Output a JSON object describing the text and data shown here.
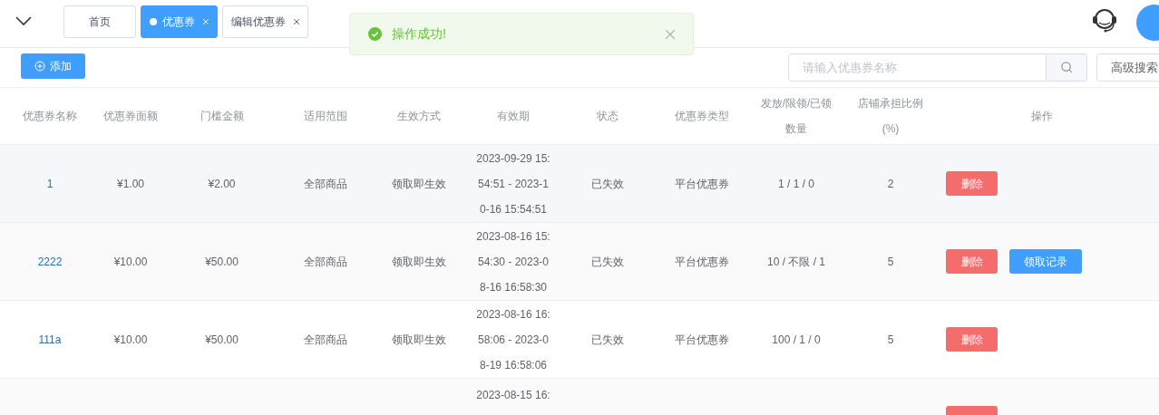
{
  "tabs": [
    {
      "label": "首页",
      "selected": false,
      "closable": false
    },
    {
      "label": "优惠券",
      "selected": true,
      "closable": true
    },
    {
      "label": "编辑优惠券",
      "selected": false,
      "closable": true
    }
  ],
  "toast": {
    "message": "操作成功!"
  },
  "toolbar": {
    "add_button": "添加",
    "search": {
      "placeholder": "请输入优惠券名称"
    },
    "advanced_search": "高级搜索"
  },
  "table": {
    "columns": [
      "优惠券名称",
      "优惠券面额",
      "门槛金额",
      "适用范围",
      "生效方式",
      "有效期",
      "状态",
      "优惠券类型",
      "发放/限领/已领数量",
      "店铺承担比例(%)",
      "操作"
    ],
    "rows": [
      {
        "cells": [
          "1",
          "¥1.00",
          "¥2.00",
          "全部商品",
          "领取即生效",
          "2023-09-29 15:54:51 - 2023-10-16 15:54:51",
          "已失效",
          "平台优惠券",
          "1 / 1 / 0",
          "2"
        ],
        "actions": [
          {
            "kind": "delete",
            "label": "删除"
          }
        ]
      },
      {
        "cells": [
          "2222",
          "¥10.00",
          "¥50.00",
          "全部商品",
          "领取即生效",
          "2023-08-16 15:54:30 - 2023-08-16 16:58:30",
          "已失效",
          "平台优惠券",
          "10 / 不限 / 1",
          "5"
        ],
        "actions": [
          {
            "kind": "delete",
            "label": "删除"
          },
          {
            "kind": "primary",
            "label": "领取记录"
          }
        ]
      },
      {
        "cells": [
          "111a",
          "¥10.00",
          "¥50.00",
          "全部商品",
          "领取即生效",
          "2023-08-16 16:58:06 - 2023-08-19 16:58:06",
          "已失效",
          "平台优惠券",
          "100 / 1 / 0",
          "5"
        ],
        "actions": [
          {
            "kind": "delete",
            "label": "删除"
          }
        ]
      },
      {
        "cells": [
          "",
          "",
          "",
          "",
          "",
          "2023-08-15 16:",
          "",
          "",
          "",
          ""
        ],
        "actions": [
          {
            "kind": "delete"
          }
        ]
      }
    ]
  }
}
